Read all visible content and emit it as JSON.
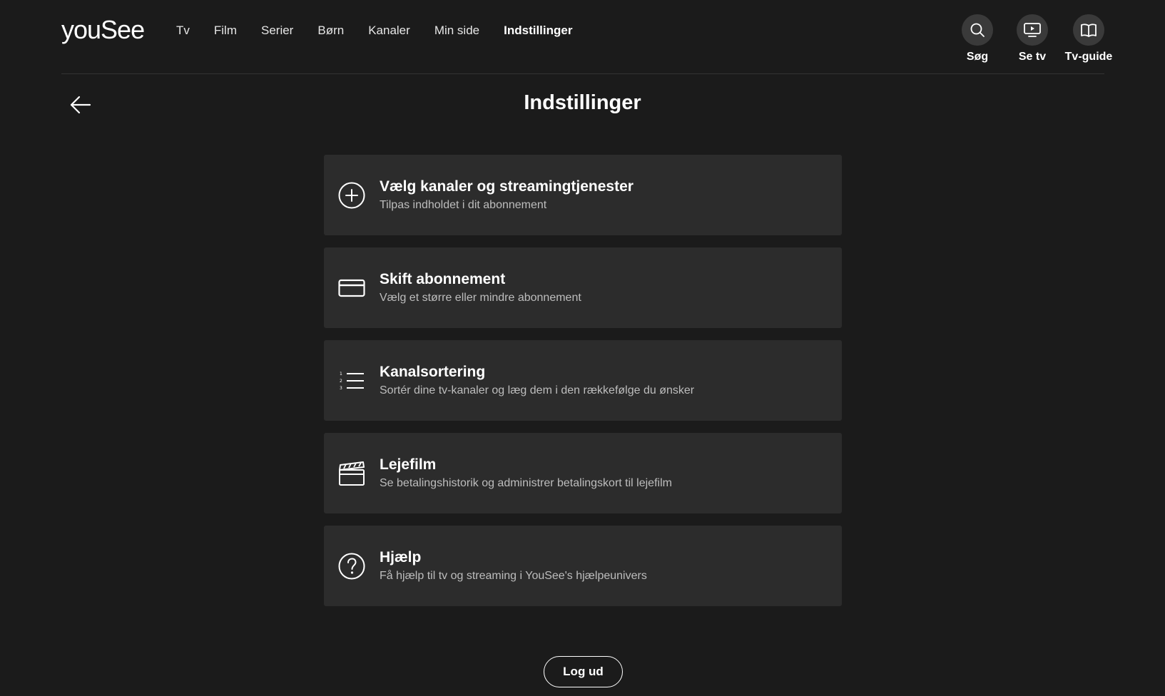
{
  "brand": {
    "logo_text": "youSee"
  },
  "nav": {
    "items": [
      {
        "label": "Tv"
      },
      {
        "label": "Film"
      },
      {
        "label": "Serier"
      },
      {
        "label": "Børn"
      },
      {
        "label": "Kanaler"
      },
      {
        "label": "Min side"
      },
      {
        "label": "Indstillinger",
        "active": true
      }
    ]
  },
  "quick_actions": {
    "search": {
      "label": "Søg",
      "icon": "search-icon"
    },
    "watch_tv": {
      "label": "Se tv",
      "icon": "tv-icon"
    },
    "tv_guide": {
      "label": "Tv-guide",
      "icon": "book-icon"
    }
  },
  "page": {
    "title": "Indstillinger"
  },
  "cards": [
    {
      "icon": "plus-circle-icon",
      "title": "Vælg kanaler og streamingtjenester",
      "subtitle": "Tilpas indholdet i dit abonnement"
    },
    {
      "icon": "credit-card-icon",
      "title": "Skift abonnement",
      "subtitle": "Vælg et større eller mindre abonnement"
    },
    {
      "icon": "numbered-list-icon",
      "title": "Kanalsortering",
      "subtitle": "Sortér dine tv-kanaler og læg dem i den rækkefølge du ønsker"
    },
    {
      "icon": "clapperboard-icon",
      "title": "Lejefilm",
      "subtitle": "Se betalingshistorik og administrer betalingskort til lejefilm"
    },
    {
      "icon": "help-circle-icon",
      "title": "Hjælp",
      "subtitle": "Få hjælp til tv og streaming i YouSee's hjælpeunivers"
    }
  ],
  "logout": {
    "label": "Log ud"
  },
  "colors": {
    "background": "#1b1b1b",
    "card": "#2c2c2c",
    "text": "#ffffff",
    "subtext": "#bdbdbd"
  }
}
